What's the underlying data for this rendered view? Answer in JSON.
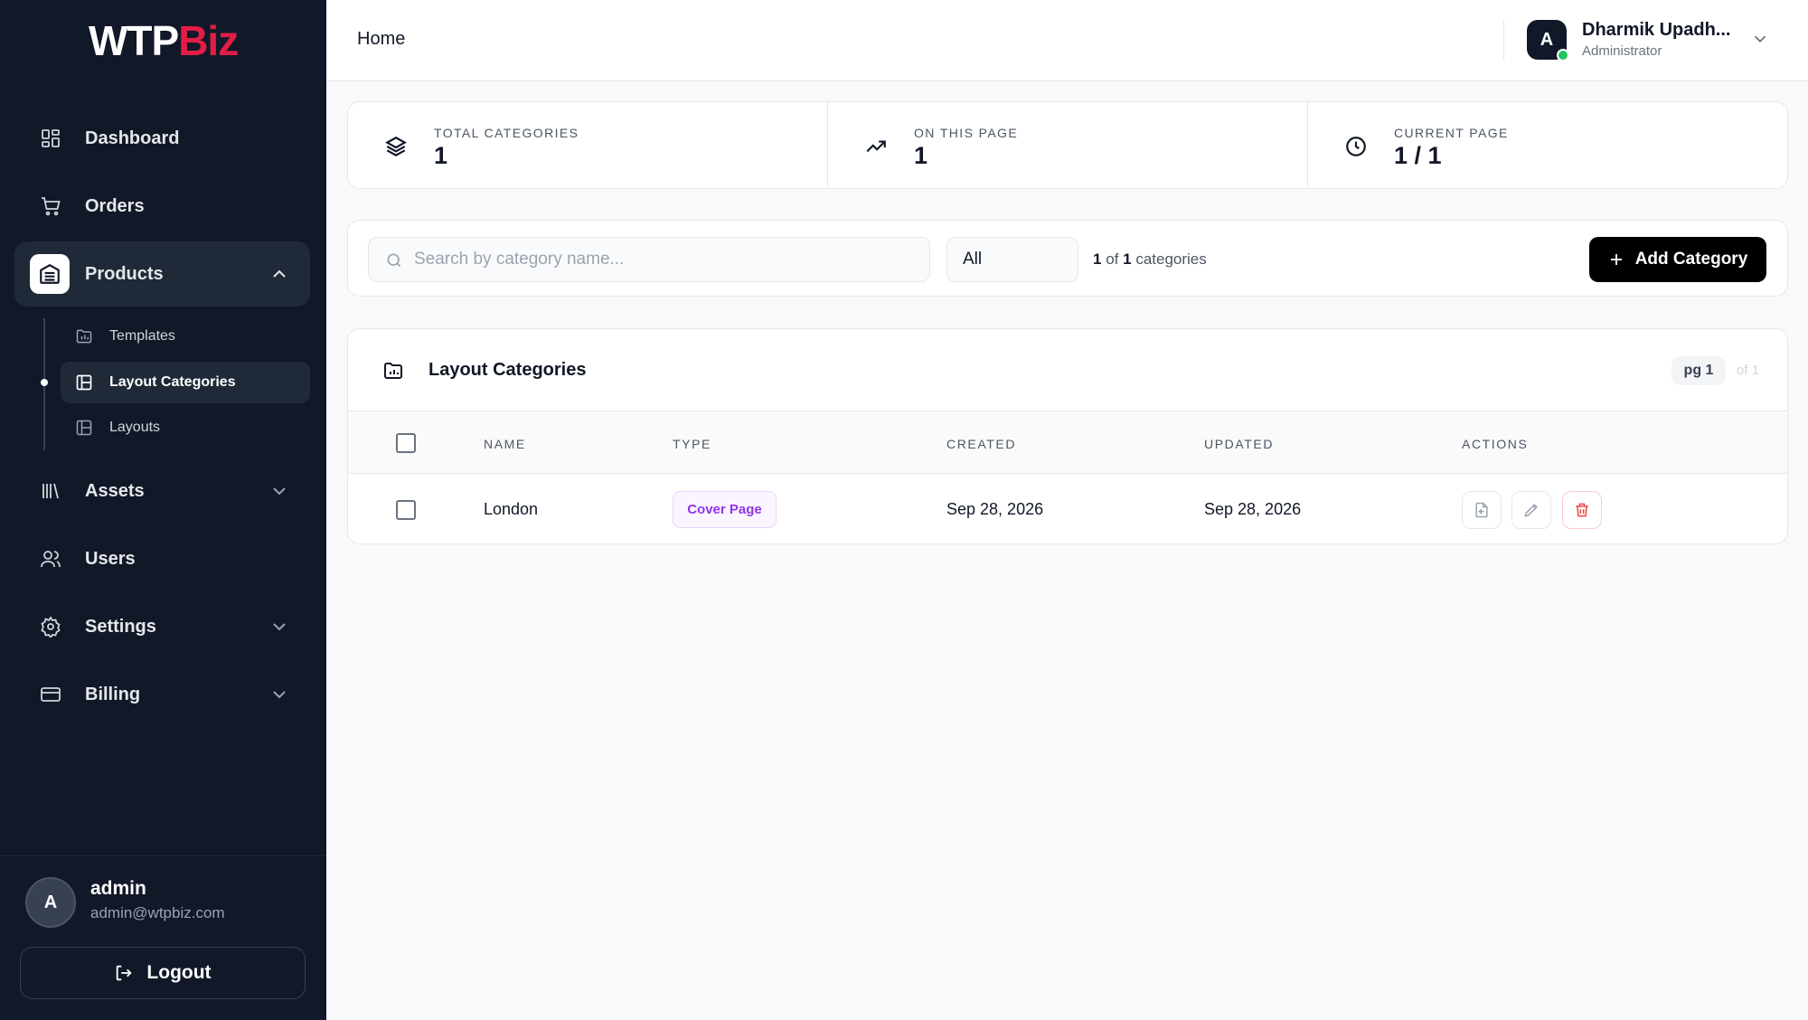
{
  "brand": {
    "part1": "WTP",
    "part2": "Biz"
  },
  "sidebar": {
    "items": [
      {
        "label": "Dashboard",
        "icon": "dashboard-grid-icon"
      },
      {
        "label": "Orders",
        "icon": "cart-icon"
      },
      {
        "label": "Products",
        "icon": "products-icon",
        "expanded": true
      },
      {
        "label": "Assets",
        "icon": "library-icon"
      },
      {
        "label": "Users",
        "icon": "users-icon"
      },
      {
        "label": "Settings",
        "icon": "gear-icon"
      },
      {
        "label": "Billing",
        "icon": "credit-card-icon"
      }
    ],
    "sub_items": [
      {
        "label": "Templates",
        "icon": "template-icon"
      },
      {
        "label": "Layout Categories",
        "icon": "layout-icon",
        "current": true
      },
      {
        "label": "Layouts",
        "icon": "layout-icon"
      }
    ],
    "account": {
      "initial": "A",
      "name": "admin",
      "email": "admin@wtpbiz.com"
    },
    "logout_label": "Logout"
  },
  "header": {
    "breadcrumb": "Home",
    "user": {
      "initial": "A",
      "name": "Dharmik Upadh...",
      "role": "Administrator",
      "status_color": "#22c55e"
    }
  },
  "stats": [
    {
      "label": "TOTAL CATEGORIES",
      "value": "1",
      "icon": "layers-icon"
    },
    {
      "label": "ON THIS PAGE",
      "value": "1",
      "icon": "trending-up-icon"
    },
    {
      "label": "CURRENT PAGE",
      "value": "1 / 1",
      "icon": "clock-icon"
    }
  ],
  "toolbar": {
    "search_placeholder": "Search by category name...",
    "search_value": "",
    "filter_selected": "All",
    "count_shown": "1",
    "count_of": "of",
    "count_total": "1",
    "count_suffix": "categories",
    "add_label": "Add Category"
  },
  "table": {
    "title": "Layout Categories",
    "page_pill": "pg 1",
    "page_of": "of 1",
    "columns": [
      "NAME",
      "TYPE",
      "CREATED",
      "UPDATED",
      "ACTIONS"
    ],
    "rows": [
      {
        "name": "London",
        "type": "Cover Page",
        "created": "Sep 28, 2026",
        "updated": "Sep 28, 2026"
      }
    ]
  },
  "colors": {
    "accent": "#e11d48",
    "sidebar_bg": "#111827",
    "badge_purple": "#9333ea",
    "danger": "#ef4444"
  }
}
